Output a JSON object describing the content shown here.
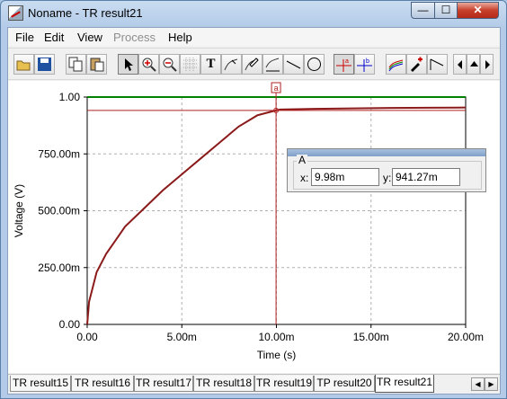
{
  "window": {
    "title": "Noname - TR result21",
    "minimize_label": "—",
    "maximize_label": "☐",
    "close_label": "✕"
  },
  "menu": [
    {
      "label": "File"
    },
    {
      "label": "Edit"
    },
    {
      "label": "View"
    },
    {
      "label": "Process",
      "disabled": true
    },
    {
      "label": "Help"
    }
  ],
  "toolbar": {
    "icons": [
      "open-folder-icon",
      "save-icon",
      "copy-icon",
      "paste-icon",
      "pointer-icon",
      "zoom-in-icon",
      "zoom-out-icon",
      "grid-icon",
      "text-tool-icon",
      "curve-label-icon",
      "pen-label-icon",
      "axis-label-icon",
      "line-tool-icon",
      "ellipse-tool-icon",
      "cursor-a-icon",
      "cursor-b-icon",
      "multi-curve-icon",
      "color-picker-icon",
      "step-icon",
      "scroll-left-icon",
      "scroll-up-icon",
      "scroll-right-icon"
    ],
    "text_tool_glyph": "T"
  },
  "chart_data": {
    "type": "line",
    "title": "",
    "xlabel": "Time (s)",
    "ylabel": "Voltage (V)",
    "xlim": [
      0,
      0.02
    ],
    "ylim": [
      0,
      1.0
    ],
    "grid": true,
    "x_ticks": [
      "0.00",
      "5.00m",
      "10.00m",
      "15.00m",
      "20.00m"
    ],
    "y_ticks": [
      "0.00",
      "250.00m",
      "500.00m",
      "750.00m",
      "1.00"
    ],
    "series": [
      {
        "color": "#8b1a1a",
        "x": [
          0,
          0.0001,
          0.0005,
          0.001,
          0.0015,
          0.002,
          0.003,
          0.004,
          0.005,
          0.006,
          0.007,
          0.008,
          0.009,
          0.00998,
          0.0102,
          0.012,
          0.014,
          0.016,
          0.018,
          0.02
        ],
        "y": [
          0,
          0.1,
          0.23,
          0.31,
          0.37,
          0.43,
          0.51,
          0.59,
          0.66,
          0.73,
          0.8,
          0.87,
          0.92,
          0.94127,
          0.945,
          0.948,
          0.95,
          0.952,
          0.953,
          0.954
        ]
      },
      {
        "color": "#008000",
        "x": [
          0,
          0.02
        ],
        "y": [
          1.0,
          1.0
        ]
      }
    ],
    "cursor": {
      "label": "a",
      "x": 0.00998,
      "y": 0.94127,
      "color": "#b22222"
    }
  },
  "cursor_panel": {
    "group_title": "A",
    "x_label": "x:",
    "x_value": "9.98m",
    "y_label": "y:",
    "y_value": "941.27m"
  },
  "tabs": [
    {
      "label": "TR result15"
    },
    {
      "label": "TR result16"
    },
    {
      "label": "TR result17"
    },
    {
      "label": "TR result18"
    },
    {
      "label": "TR result19"
    },
    {
      "label": "TP result20"
    },
    {
      "label": "TR result21",
      "active": true
    }
  ],
  "tab_nav": {
    "left": "◀",
    "right": "▶"
  }
}
